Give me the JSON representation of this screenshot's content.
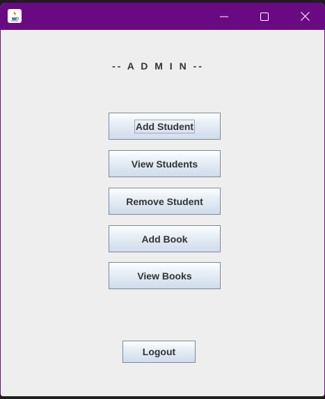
{
  "window": {
    "controls": {
      "minimize_icon": "minimize-icon",
      "maximize_icon": "maximize-icon",
      "close_icon": "close-icon"
    },
    "title_color": "#6a0a83"
  },
  "main": {
    "heading": "-- A D M I N --",
    "buttons": {
      "add_student": "Add Student",
      "view_students": "View Students",
      "remove_student": "Remove Student",
      "add_book": "Add Book",
      "view_books": "View Books",
      "logout": "Logout"
    }
  }
}
